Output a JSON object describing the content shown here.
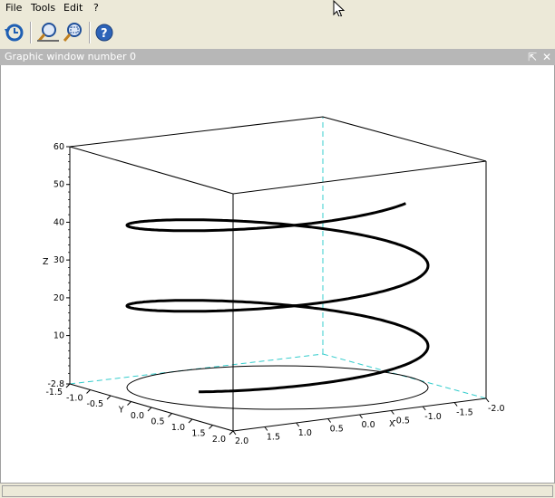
{
  "menu": {
    "items": [
      {
        "label": "File"
      },
      {
        "label": "Tools"
      },
      {
        "label": "Edit"
      },
      {
        "label": "?"
      }
    ]
  },
  "toolbar": {
    "buttons": [
      {
        "icon": "rotate-icon"
      },
      {
        "icon": "zoom-icon"
      },
      {
        "icon": "unzoom-icon"
      },
      {
        "icon": "help-icon"
      }
    ]
  },
  "window": {
    "title": "Graphic window number 0",
    "undock_icon": "undock-icon",
    "close_icon": "close-icon"
  },
  "colors": {
    "hidden_edges": "#33cccc",
    "curve": "#000000",
    "titlebar": "#b7b7b7"
  },
  "chart_data": {
    "type": "line",
    "projection": "3d",
    "series": [
      {
        "param": "t from 0 to 4π (≈2.2 turns)",
        "x": "2*cos(t)",
        "y": "2*sin(t)",
        "z": "t*(approx 3.8 units per radian, 0 to 48)"
      }
    ],
    "base_circle": {
      "radius": 2,
      "z": -2.8
    },
    "xlabel": "X",
    "ylabel": "Y",
    "zlabel": "Z",
    "xlim": [
      -2.0,
      2.0
    ],
    "ylim": [
      -2.0,
      2.0
    ],
    "zlim": [
      -2.8,
      60
    ],
    "x_ticks": [
      "2.0",
      "1.5",
      "1.0",
      "0.5",
      "0.0",
      "-0.5",
      "-1.0",
      "-1.5",
      "-2.0"
    ],
    "y_ticks": [
      "-1.5",
      "-1.0",
      "-0.5",
      "Y",
      "0.0",
      "0.5",
      "1.0",
      "1.5",
      "2.0"
    ],
    "z_ticks": [
      "-2.8",
      "10",
      "20",
      "30",
      "40",
      "50",
      "60"
    ]
  }
}
